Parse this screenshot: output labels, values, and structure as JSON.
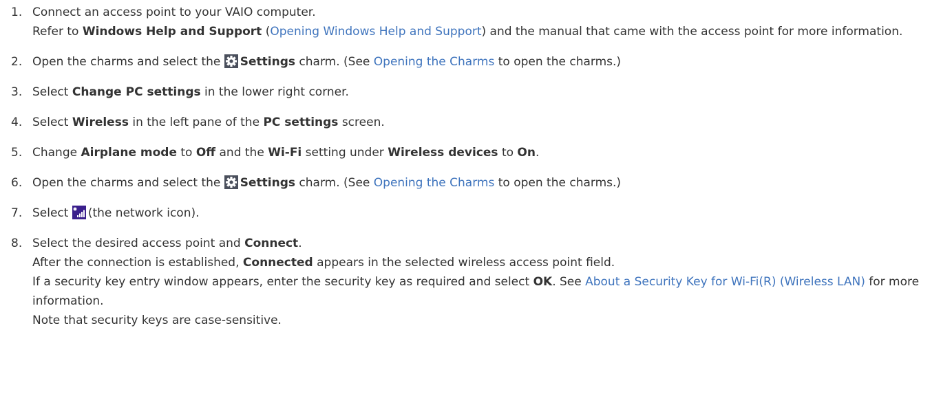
{
  "steps": [
    {
      "number": "1.",
      "line1": "Connect an access point to your VAIO computer.",
      "refer_pre": "Refer to ",
      "help_bold": "Windows Help and Support",
      "paren_open": " (",
      "help_link": "Opening Windows Help and Support",
      "paren_close_rest": ") and the manual that came with the access point for more information."
    },
    {
      "number": "2.",
      "pre": "Open the charms and select the ",
      "icon": "settings-gear-icon",
      "bold": "Settings",
      "mid": " charm. (See ",
      "link": "Opening the Charms",
      "post": " to open the charms.)"
    },
    {
      "number": "3.",
      "pre": "Select ",
      "bold": "Change PC settings",
      "post": " in the lower right corner."
    },
    {
      "number": "4.",
      "pre": "Select ",
      "bold1": "Wireless",
      "mid": " in the left pane of the ",
      "bold2": "PC settings",
      "post": " screen."
    },
    {
      "number": "5.",
      "t1": "Change ",
      "b1": "Airplane mode",
      "t2": " to ",
      "b2": "Off",
      "t3": " and the ",
      "b3": "Wi-Fi",
      "t4": " setting under ",
      "b4": "Wireless devices",
      "t5": " to ",
      "b5": "On",
      "t6": "."
    },
    {
      "number": "6.",
      "pre": "Open the charms and select the ",
      "icon": "settings-gear-icon",
      "bold": "Settings",
      "mid": " charm. (See ",
      "link": "Opening the Charms",
      "post": " to open the charms.)"
    },
    {
      "number": "7.",
      "pre": "Select ",
      "icon": "network-icon",
      "post": "(the network icon)."
    },
    {
      "number": "8.",
      "l1_pre": "Select the desired access point and ",
      "l1_bold": "Connect",
      "l1_post": ".",
      "l2_pre": "After the connection is established, ",
      "l2_bold": "Connected",
      "l2_post": " appears in the selected wireless access point field.",
      "l3_pre": "If a security key entry window appears, enter the security key as required and select ",
      "l3_bold": "OK",
      "l3_mid": ". See ",
      "l3_link": "About a Security Key for Wi-Fi(R) (Wireless LAN)",
      "l3_post": " for more information.",
      "l4": "Note that security keys are case-sensitive."
    }
  ],
  "colors": {
    "text": "#333333",
    "link": "#3f74bd",
    "settings_icon_bg": "#4a4f5c",
    "network_icon_bg": "#3a1f8c"
  }
}
